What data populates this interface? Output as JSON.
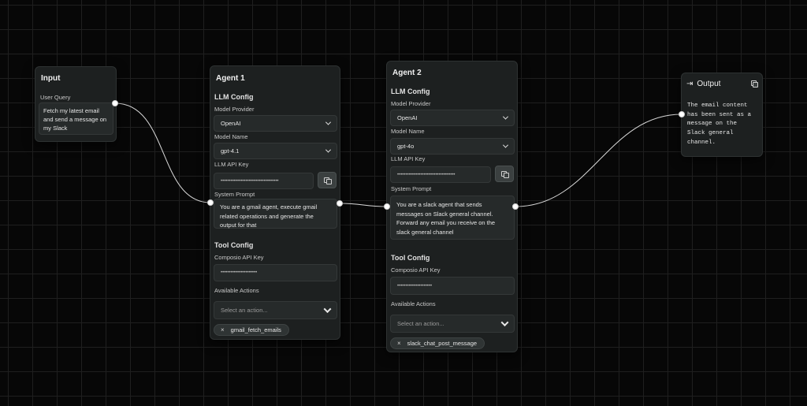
{
  "input_node": {
    "title": "Input",
    "field_label": "User Query",
    "value": "Fetch my latest email and send a message on my Slack"
  },
  "agent1": {
    "title": "Agent 1",
    "llm_config_title": "LLM Config",
    "model_provider_label": "Model Provider",
    "model_provider_value": "OpenAI",
    "model_name_label": "Model Name",
    "model_name_value": "gpt-4.1",
    "api_key_label": "LLM API Key",
    "api_key_value": "•••••••••••••••••••••••••••••••••••",
    "system_prompt_label": "System Prompt",
    "system_prompt_value": "You are a gmail agent, execute gmail related operations and generate the output for that",
    "tool_config_title": "Tool Config",
    "composio_key_label": "Composio API Key",
    "composio_key_value": "••••••••••••••••••••••",
    "actions_label": "Available Actions",
    "actions_placeholder": "Select an action...",
    "selected_action": "gmail_fetch_emails",
    "chip_remove": "×"
  },
  "agent2": {
    "title": "Agent 2",
    "llm_config_title": "LLM Config",
    "model_provider_label": "Model Provider",
    "model_provider_value": "OpenAI",
    "model_name_label": "Model Name",
    "model_name_value": "gpt-4o",
    "api_key_label": "LLM API Key",
    "api_key_value": "•••••••••••••••••••••••••••••••••••",
    "system_prompt_label": "System Prompt",
    "system_prompt_value": "You are a slack agent that sends messages on Slack general channel. Forward any email you receive on the slack general channel",
    "tool_config_title": "Tool Config",
    "composio_key_label": "Composio API Key",
    "composio_key_value": "•••••••••••••••••••••",
    "actions_label": "Available Actions",
    "actions_placeholder": "Select an action...",
    "selected_action": "slack_chat_post_message",
    "chip_remove": "×"
  },
  "output_node": {
    "title": "Output",
    "title_icon": "⇥",
    "value": "The email content has been sent as a message on the Slack general channel."
  },
  "icons": {
    "output": "logout-arrow-icon",
    "copy": "copy-icon",
    "chevron": "chevron-down-icon",
    "close": "close-icon"
  },
  "colors": {
    "canvas": "#070707",
    "grid": "#1f1f1f",
    "node": "#1d2020",
    "edge": "#d9d9d9",
    "port": "#ffffff"
  }
}
